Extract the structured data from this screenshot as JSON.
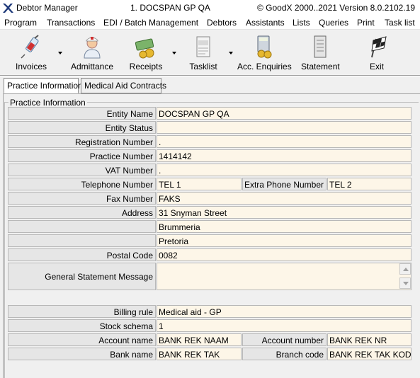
{
  "window": {
    "app_title": "Debtor Manager",
    "document_title": "1. DOCSPAN GP QA",
    "copyright": "© GoodX 2000..2021  Version 8.0.2102.19"
  },
  "menu": [
    "Program",
    "Transactions",
    "EDI / Batch Management",
    "Debtors",
    "Assistants",
    "Lists",
    "Queries",
    "Print",
    "Task list"
  ],
  "toolbar": {
    "invoices": {
      "label": "Invoices",
      "icon": "syringe-icon"
    },
    "admittance": {
      "label": "Admittance",
      "icon": "nurse-icon"
    },
    "receipts": {
      "label": "Receipts",
      "icon": "money-icon"
    },
    "tasklist": {
      "label": "Tasklist",
      "icon": "task-icon"
    },
    "acc_enquiries": {
      "label": "Acc. Enquiries",
      "icon": "calculator-coins-icon"
    },
    "statement": {
      "label": "Statement",
      "icon": "statement-icon"
    },
    "exit": {
      "label": "Exit",
      "icon": "checkered-flag-icon"
    }
  },
  "tabs": {
    "practice_information": "Practice Information",
    "medical_aid_contracts": "Medical Aid Contracts"
  },
  "group_title": "Practice Information",
  "fields": {
    "entity_name": {
      "label": "Entity Name",
      "value": "DOCSPAN GP QA"
    },
    "entity_status": {
      "label": "Entity Status",
      "value": ""
    },
    "registration_number": {
      "label": "Registration Number",
      "value": "."
    },
    "practice_number": {
      "label": "Practice Number",
      "value": "1414142"
    },
    "vat_number": {
      "label": "VAT Number",
      "value": "."
    },
    "telephone_number": {
      "label": "Telephone Number",
      "value": "TEL 1"
    },
    "extra_phone_number": {
      "label": "Extra Phone Number",
      "value": "TEL 2"
    },
    "fax_number": {
      "label": "Fax Number",
      "value": "FAKS"
    },
    "address": {
      "label": "Address",
      "value": "31 Snyman Street",
      "line2": "Brummeria",
      "line3": "Pretoria"
    },
    "postal_code": {
      "label": "Postal Code",
      "value": "0082"
    },
    "general_statement_message": {
      "label": "General Statement Message",
      "value": ""
    },
    "billing_rule": {
      "label": "Billing rule",
      "value": "Medical aid - GP"
    },
    "stock_schema": {
      "label": "Stock schema",
      "value": "1"
    },
    "account_name": {
      "label": "Account name",
      "value": "BANK REK NAAM"
    },
    "account_number": {
      "label": "Account number",
      "value": "BANK REK NR"
    },
    "bank_name": {
      "label": "Bank name",
      "value": "BANK REK TAK"
    },
    "branch_code": {
      "label": "Branch code",
      "value": "BANK REK TAK KODE"
    }
  }
}
